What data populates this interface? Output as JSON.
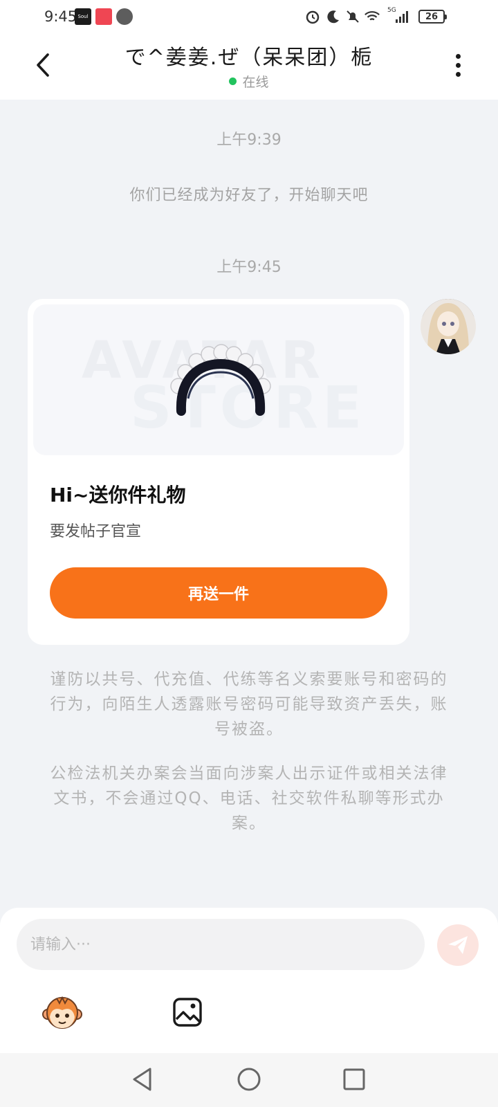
{
  "status_bar": {
    "time": "9:45",
    "app_badge_soul": "Soul",
    "battery": "26",
    "network": "5G"
  },
  "header": {
    "title": "で^姜姜.ぜ（呆呆团）栀",
    "status": "在线"
  },
  "messages": {
    "timestamp_1": "上午9:39",
    "system_notice": "你们已经成为好友了，开始聊天吧",
    "timestamp_2": "上午9:45",
    "gift_card": {
      "watermark_line1": "AVATAR",
      "watermark_line2": "STORE",
      "title": "Hi~送你件礼物",
      "subtitle": "要发帖子官宣",
      "button_label": "再送一件",
      "button_color": "#f87219"
    },
    "warning_1": "谨防以共号、代充值、代练等名义索要账号和密码的行为，向陌生人透露账号密码可能导致资产丢失，账号被盗。",
    "warning_2": "公检法机关办案会当面向涉案人出示证件或相关法律文书，不会通过QQ、电话、社交软件私聊等形式办案。"
  },
  "input_bar": {
    "placeholder": "请输入···"
  },
  "icons": {
    "back": "chevron-left-icon",
    "more": "more-vertical-icon",
    "send": "paper-plane-icon",
    "emoji": "monkey-emoji-icon",
    "image": "image-icon"
  },
  "colors": {
    "accent": "#f87219",
    "online": "#22c35e",
    "background": "#f1f3f6"
  }
}
